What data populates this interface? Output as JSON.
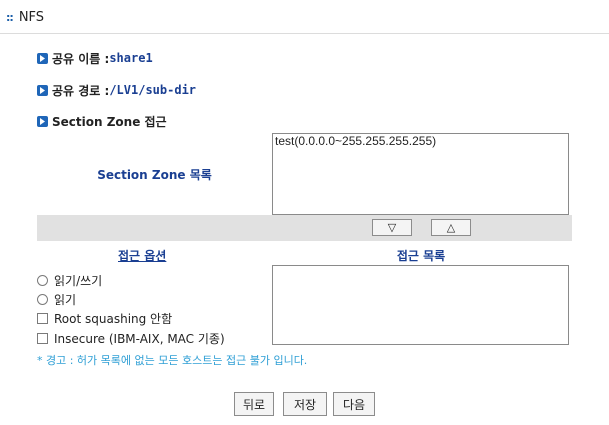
{
  "header": {
    "title": "NFS"
  },
  "share": {
    "name_label": "공유 이름 : ",
    "name_value": "share1",
    "path_label": "공유 경로 : ",
    "path_value": "/LV1/sub-dir",
    "section_access_label": "Section Zone 접근"
  },
  "section_zone": {
    "list_label": "Section Zone 목록",
    "items": [
      "test(0.0.0.0~255.255.255.255)"
    ]
  },
  "arrows": {
    "down": "▽",
    "up": "△"
  },
  "access": {
    "options_header": "접근 옵션",
    "list_header": "접근 목록",
    "options": [
      {
        "type": "radio",
        "label": "읽기/쓰기"
      },
      {
        "type": "radio",
        "label": "읽기"
      },
      {
        "type": "checkbox",
        "label": "Root squashing 안함"
      },
      {
        "type": "checkbox",
        "label": "Insecure (IBM-AIX, MAC 기종)"
      }
    ]
  },
  "warning": "* 경고 : 허가 목록에 없는 모든 호스트는 접근 불가 입니다.",
  "buttons": {
    "back": "뒤로",
    "save": "저장",
    "next": "다음"
  }
}
